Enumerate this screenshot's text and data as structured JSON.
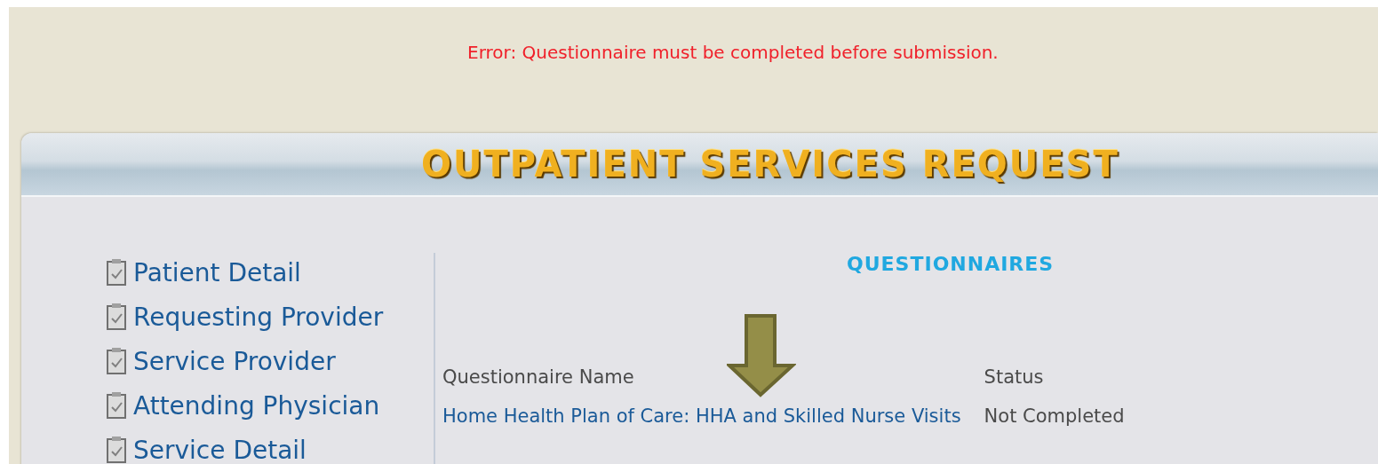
{
  "error_message": "Error: Questionnaire must be completed before submission.",
  "panel": {
    "title": "OUTPATIENT SERVICES REQUEST"
  },
  "sidebar": {
    "items": [
      {
        "label": "Patient Detail"
      },
      {
        "label": "Requesting Provider"
      },
      {
        "label": "Service Provider"
      },
      {
        "label": "Attending Physician"
      },
      {
        "label": "Service Detail"
      }
    ]
  },
  "questionnaires": {
    "heading": "QUESTIONNAIRES",
    "columns": [
      "Questionnaire Name",
      "Status"
    ],
    "rows": [
      {
        "name": "Home Health Plan of Care: HHA and Skilled Nurse Visits",
        "status": "Not Completed"
      }
    ]
  }
}
